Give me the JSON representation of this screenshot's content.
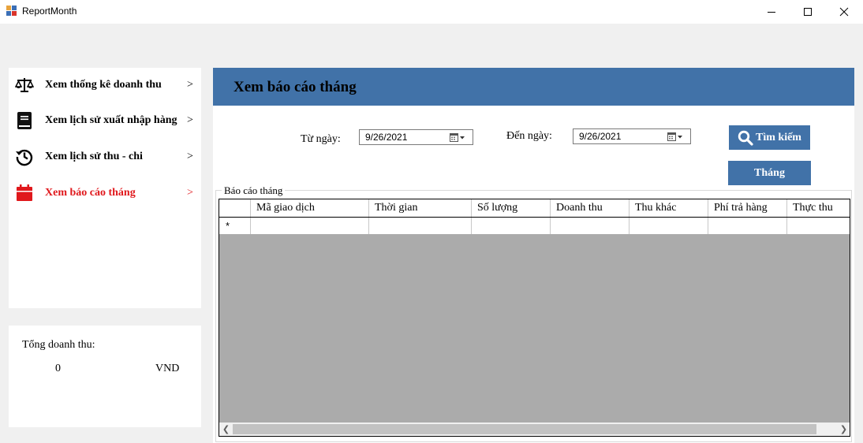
{
  "window": {
    "title": "ReportMonth",
    "minimize": "minimize",
    "maximize": "maximize",
    "close": "close"
  },
  "sidebar": {
    "items": [
      {
        "label": "Xem thống kê doanh thu",
        "arrow": ">",
        "icon": "balance-scale-icon",
        "active": false
      },
      {
        "label": "Xem lịch sử xuất nhập hàng",
        "arrow": ">",
        "icon": "book-icon",
        "active": false
      },
      {
        "label": "Xem lịch sử thu - chi",
        "arrow": ">",
        "icon": "history-icon",
        "active": false
      },
      {
        "label": "Xem báo cáo tháng",
        "arrow": ">",
        "icon": "calendar-icon",
        "active": true
      }
    ],
    "active_color": "#e0181c"
  },
  "revenue": {
    "label": "Tổng doanh thu:",
    "value": "0",
    "unit": "VND"
  },
  "main": {
    "title": "Xem báo cáo tháng",
    "header_color": "#4172a8",
    "from_label": "Từ ngày:",
    "from_date": "9/26/2021",
    "to_label": "Đến ngày:",
    "to_date": "9/26/2021",
    "search_button": "Tìm kiếm",
    "month_button": "Tháng",
    "group_title": "Báo cáo tháng",
    "columns": [
      "Mã giao dịch",
      "Thời gian",
      "Số lượng",
      "Doanh thu",
      "Thu khác",
      "Phí trả hàng",
      "Thực thu"
    ],
    "new_row_marker": "*"
  }
}
